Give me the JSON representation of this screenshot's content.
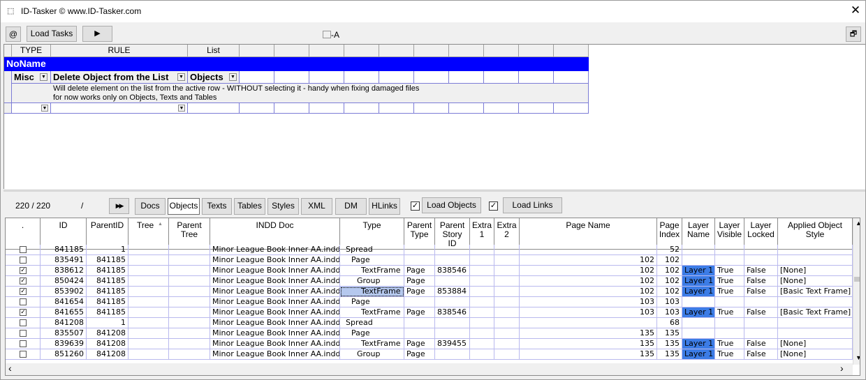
{
  "window": {
    "title": "ID-Tasker  © www.ID-Tasker.com",
    "close_glyph": "✕",
    "app_icon": "app-icon"
  },
  "toolbar": {
    "at_label": "@",
    "load_tasks_label": "Load Tasks",
    "play_glyph": "▶",
    "center_label": "⃞-A",
    "restore_glyph": "🗗"
  },
  "rules": {
    "headers": [
      "TYPE",
      "RULE",
      "List"
    ],
    "banner": "NoName",
    "type_value": "Misc",
    "rule_value": "Delete Object from the List",
    "list_value": "Objects",
    "desc_line1": "Will delete element on the list from the active row - WITHOUT selecting it - handy when fixing damaged files",
    "desc_line2": "for now works only on Objects, Texts and Tables",
    "banner_color": "#0000ff"
  },
  "lower_toolbar": {
    "counter": "220 / 220",
    "slash": "/",
    "ff_glyph": "▶▶",
    "tabs": [
      "Docs",
      "Objects",
      "Texts",
      "Tables",
      "Styles",
      "XML",
      "DM",
      "HLinks"
    ],
    "active_tab": "Objects",
    "load_objects_label": "Load Objects",
    "load_objects_checked": "✓",
    "load_links_label": "Load Links",
    "load_links_checked": "✓"
  },
  "grid": {
    "columns": [
      ".",
      "ID",
      "ParentID",
      "Tree",
      "Parent\nTree",
      "INDD Doc",
      "Type",
      "Parent\nType",
      "Parent\nStory\nID",
      "Extra\n1",
      "Extra\n2",
      "Page Name",
      "Page\nIndex",
      "Layer\nName",
      "Layer\nVisible",
      "Layer\nLocked",
      "Applied Object\nStyle"
    ],
    "sort_glyph": "▲",
    "rows": [
      {
        "chk": "",
        "id": "841185",
        "pid": "1",
        "doc": "Minor League Book Inner AA.indd",
        "type": "Spread",
        "indent": 2,
        "ptype": "",
        "pstory": "",
        "pname": "",
        "pidx": "52",
        "layer": "",
        "vis": "",
        "lock": "",
        "style": ""
      },
      {
        "chk": "",
        "id": "835491",
        "pid": "841185",
        "doc": "Minor League Book Inner AA.indd",
        "type": "Page",
        "indent": 4,
        "ptype": "",
        "pstory": "",
        "pname": "102",
        "pidx": "102",
        "layer": "",
        "vis": "",
        "lock": "",
        "style": ""
      },
      {
        "chk": "✓",
        "id": "838612",
        "pid": "841185",
        "doc": "Minor League Book Inner AA.indd",
        "type": "TextFrame",
        "indent": 0,
        "ptype": "Page",
        "pstory": "838546",
        "pname": "102",
        "pidx": "102",
        "layer": "Layer 1",
        "vis": "True",
        "lock": "False",
        "style": "[None]"
      },
      {
        "chk": "✓",
        "id": "850424",
        "pid": "841185",
        "doc": "Minor League Book Inner AA.indd",
        "type": "Group",
        "indent": 6,
        "ptype": "Page",
        "pstory": "",
        "pname": "102",
        "pidx": "102",
        "layer": "Layer 1",
        "vis": "True",
        "lock": "False",
        "style": "[None]"
      },
      {
        "chk": "✓",
        "id": "853902",
        "pid": "841185",
        "doc": "Minor League Book Inner AA.indd",
        "type": "TextFrame",
        "indent": 0,
        "ptype": "Page",
        "pstory": "853884",
        "pname": "102",
        "pidx": "102",
        "layer": "Layer 1",
        "vis": "True",
        "lock": "False",
        "style": "[Basic Text Frame]",
        "selected": true
      },
      {
        "chk": "",
        "id": "841654",
        "pid": "841185",
        "doc": "Minor League Book Inner AA.indd",
        "type": "Page",
        "indent": 4,
        "ptype": "",
        "pstory": "",
        "pname": "103",
        "pidx": "103",
        "layer": "",
        "vis": "",
        "lock": "",
        "style": ""
      },
      {
        "chk": "✓",
        "id": "841655",
        "pid": "841185",
        "doc": "Minor League Book Inner AA.indd",
        "type": "TextFrame",
        "indent": 0,
        "ptype": "Page",
        "pstory": "838546",
        "pname": "103",
        "pidx": "103",
        "layer": "Layer 1",
        "vis": "True",
        "lock": "False",
        "style": "[Basic Text Frame]"
      },
      {
        "chk": "",
        "id": "841208",
        "pid": "1",
        "doc": "Minor League Book Inner AA.indd",
        "type": "Spread",
        "indent": 2,
        "ptype": "",
        "pstory": "",
        "pname": "",
        "pidx": "68",
        "layer": "",
        "vis": "",
        "lock": "",
        "style": ""
      },
      {
        "chk": "",
        "id": "835507",
        "pid": "841208",
        "doc": "Minor League Book Inner AA.indd",
        "type": "Page",
        "indent": 4,
        "ptype": "",
        "pstory": "",
        "pname": "135",
        "pidx": "135",
        "layer": "",
        "vis": "",
        "lock": "",
        "style": ""
      },
      {
        "chk": "",
        "id": "839639",
        "pid": "841208",
        "doc": "Minor League Book Inner AA.indd",
        "type": "TextFrame",
        "indent": 0,
        "ptype": "Page",
        "pstory": "839455",
        "pname": "135",
        "pidx": "135",
        "layer": "Layer 1",
        "vis": "True",
        "lock": "False",
        "style": "[None]"
      },
      {
        "chk": "",
        "id": "851260",
        "pid": "841208",
        "doc": "Minor League Book Inner AA.indd",
        "type": "Group",
        "indent": 6,
        "ptype": "Page",
        "pstory": "",
        "pname": "135",
        "pidx": "135",
        "layer": "Layer 1",
        "vis": "True",
        "lock": "False",
        "style": "[None]"
      }
    ],
    "scroll_up": "▲",
    "scroll_down": "▼",
    "scroll_left": "‹",
    "scroll_right": "›",
    "layer_color": "#3c7ce6"
  }
}
